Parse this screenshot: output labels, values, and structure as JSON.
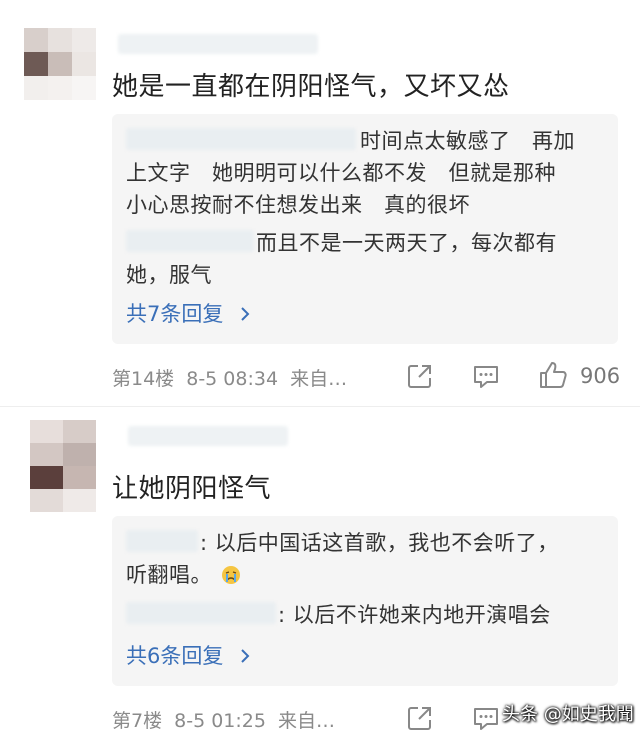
{
  "comments": [
    {
      "text": "她是一直都在阴阳怪气，又坏又怂",
      "replies": [
        {
          "lines": [
            "时间点太敏感了　再加",
            "上文字　她明明可以什么都不发　但就是那种",
            "小心思按耐不住想发出来　真的很坏"
          ]
        },
        {
          "lines": [
            "而且不是一天两天了，每次都有",
            "她，服气"
          ]
        }
      ],
      "more_replies": "共7条回复",
      "floor": "第14楼",
      "time": "8-5 08:34",
      "source": "来自…",
      "like_count": "906"
    },
    {
      "text": "让她阴阳怪气",
      "replies": [
        {
          "lines": [
            ": 以后中国话这首歌，我也不会听了，",
            "听翻唱。"
          ]
        },
        {
          "lines": [
            ": 以后不许她来内地开演唱会"
          ]
        }
      ],
      "more_replies": "共6条回复",
      "floor": "第7楼",
      "time": "8-5 01:25",
      "source": "来自…"
    }
  ],
  "watermark": "头条 @如史我聞",
  "colors": {
    "link": "#3a6fb8",
    "meta": "#8a8a8a",
    "reply_bg": "#f5f5f5"
  }
}
